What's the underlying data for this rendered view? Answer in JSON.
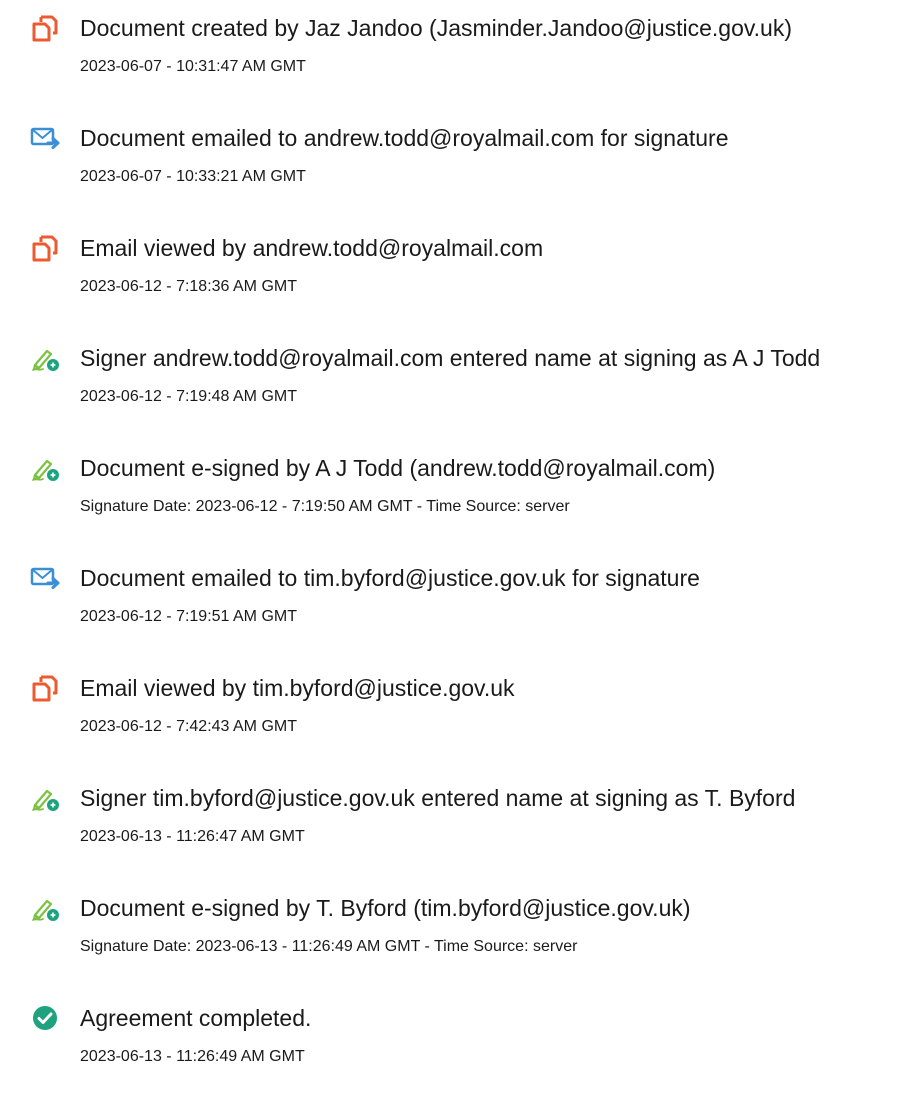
{
  "events": [
    {
      "icon": "document-created-icon",
      "title": "Document created by Jaz Jandoo (Jasminder.Jandoo@justice.gov.uk)",
      "time": "2023-06-07 - 10:31:47 AM GMT"
    },
    {
      "icon": "email-sent-icon",
      "title": "Document emailed to andrew.todd@royalmail.com for signature",
      "time": "2023-06-07 - 10:33:21 AM GMT"
    },
    {
      "icon": "email-viewed-icon",
      "title": "Email viewed by andrew.todd@royalmail.com",
      "time": "2023-06-12 - 7:18:36 AM GMT"
    },
    {
      "icon": "signer-pen-icon",
      "title": "Signer andrew.todd@royalmail.com entered name at signing as A J Todd",
      "time": "2023-06-12 - 7:19:48 AM GMT"
    },
    {
      "icon": "signer-pen-icon",
      "title": "Document e-signed by A J Todd (andrew.todd@royalmail.com)",
      "time": "Signature Date: 2023-06-12 - 7:19:50 AM GMT - Time Source: server"
    },
    {
      "icon": "email-sent-icon",
      "title": "Document emailed to tim.byford@justice.gov.uk for signature",
      "time": "2023-06-12 - 7:19:51 AM GMT"
    },
    {
      "icon": "email-viewed-icon",
      "title": "Email viewed by tim.byford@justice.gov.uk",
      "time": "2023-06-12 - 7:42:43 AM GMT"
    },
    {
      "icon": "signer-pen-icon",
      "title": "Signer tim.byford@justice.gov.uk entered name at signing as T. Byford",
      "time": "2023-06-13 - 11:26:47 AM GMT"
    },
    {
      "icon": "signer-pen-icon",
      "title": "Document e-signed by T. Byford (tim.byford@justice.gov.uk)",
      "time": "Signature Date: 2023-06-13 - 11:26:49 AM GMT - Time Source: server"
    },
    {
      "icon": "completed-check-icon",
      "title": "Agreement completed.",
      "time": "2023-06-13 - 11:26:49 AM GMT"
    }
  ],
  "colors": {
    "document_icon": "#ec5a2f",
    "email_icon": "#3a8fd6",
    "pen_icon": "#7cc242",
    "completed_icon": "#1fa37f",
    "text": "#1a1a1a"
  }
}
